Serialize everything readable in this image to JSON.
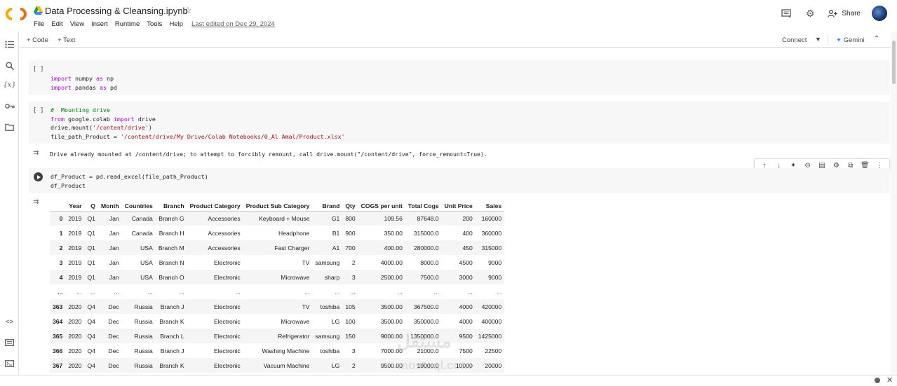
{
  "header": {
    "title": "Data Processing & Cleansing.ipynb",
    "menu": [
      "File",
      "Edit",
      "View",
      "Insert",
      "Runtime",
      "Tools",
      "Help"
    ],
    "last_edited": "Last edited on Dec 29, 2024",
    "share_label": "Share"
  },
  "toolbar": {
    "code_label": "+ Code",
    "text_label": "+ Text",
    "connect_label": "Connect",
    "gemini_label": "Gemini"
  },
  "cells": {
    "c1": {
      "bracket": "[ ]",
      "lines": [
        "import numpy as np",
        "import pandas as pd"
      ]
    },
    "c2": {
      "bracket": "[ ]",
      "lines": [
        "# Mounting drive",
        "from google.colab import drive",
        "drive.mount('/content/drive')",
        "file_path_Product = '/content/drive/My Drive/Colab Notebooks/0_Al Amal/Product.xlsx'"
      ],
      "output": "Drive already mounted at /content/drive; to attempt to forcibly remount, call drive.mount(\"/content/drive\", force_remount=True)."
    },
    "c3": {
      "lines": [
        "df_Product = pd.read_excel(file_path_Product)",
        "df_Product"
      ]
    }
  },
  "dataframe": {
    "columns": [
      "",
      "Year",
      "Q",
      "Month",
      "Countries",
      "Branch",
      "Product Category",
      "Product Sub Category",
      "Brand",
      "Qty",
      "COGS per unit",
      "Total Cogs",
      "Unit Price",
      "Sales"
    ],
    "rows": [
      [
        "0",
        "2019",
        "Q1",
        "Jan",
        "Canada",
        "Branch G",
        "Accessories",
        "Keyboard + Mouse",
        "G1",
        "800",
        "109.56",
        "87648.0",
        "200",
        "160000"
      ],
      [
        "1",
        "2019",
        "Q1",
        "Jan",
        "Canada",
        "Branch H",
        "Accessories",
        "Headphone",
        "B1",
        "900",
        "350.00",
        "315000.0",
        "400",
        "360000"
      ],
      [
        "2",
        "2019",
        "Q1",
        "Jan",
        "USA",
        "Branch M",
        "Accessories",
        "Fast Charger",
        "A1",
        "700",
        "400.00",
        "280000.0",
        "450",
        "315000"
      ],
      [
        "3",
        "2019",
        "Q1",
        "Jan",
        "USA",
        "Branch N",
        "Electronic",
        "TV",
        "samsung",
        "2",
        "4000.00",
        "8000.0",
        "4500",
        "9000"
      ],
      [
        "4",
        "2019",
        "Q1",
        "Jan",
        "USA",
        "Branch O",
        "Electronic",
        "Microwave",
        "sharp",
        "3",
        "2500.00",
        "7500.0",
        "3000",
        "9000"
      ],
      [
        "...",
        "...",
        "...",
        "...",
        "...",
        "...",
        "...",
        "...",
        "...",
        "...",
        "...",
        "...",
        "...",
        "..."
      ],
      [
        "363",
        "2020",
        "Q4",
        "Dec",
        "Russia",
        "Branch J",
        "Electronic",
        "TV",
        "toshiba",
        "105",
        "3500.00",
        "367500.0",
        "4000",
        "420000"
      ],
      [
        "364",
        "2020",
        "Q4",
        "Dec",
        "Russia",
        "Branch K",
        "Electronic",
        "Microwave",
        "LG",
        "100",
        "3500.00",
        "350000.0",
        "4000",
        "400000"
      ],
      [
        "365",
        "2020",
        "Q4",
        "Dec",
        "Russia",
        "Branch L",
        "Electronic",
        "Refrigerator",
        "samsung",
        "150",
        "9000.00",
        "1350000.0",
        "9500",
        "1425000"
      ],
      [
        "366",
        "2020",
        "Q4",
        "Dec",
        "Russia",
        "Branch J",
        "Electronic",
        "Washing Machine",
        "toshiba",
        "3",
        "7000.00",
        "21000.0",
        "7500",
        "22500"
      ],
      [
        "367",
        "2020",
        "Q4",
        "Dec",
        "Russia",
        "Branch K",
        "Electronic",
        "Vacuum Machine",
        "LG",
        "2",
        "9500.00",
        "19000.0",
        "10000",
        "20000"
      ]
    ]
  },
  "watermark": {
    "arabic": "مستقل",
    "latin": "mostaql.com"
  },
  "colors": {
    "keyword": "#af00db",
    "comment": "#008000",
    "string": "#a31515",
    "cell_bg": "#f7f7f7"
  },
  "icons": [
    "colab-logo",
    "drive-icon",
    "star-icon",
    "comment-icon",
    "gear-icon",
    "share-icon",
    "toc-icon",
    "search-icon",
    "variables-icon",
    "secrets-icon",
    "folder-icon",
    "code-snippets-icon",
    "command-palette-icon",
    "terminal-icon"
  ]
}
